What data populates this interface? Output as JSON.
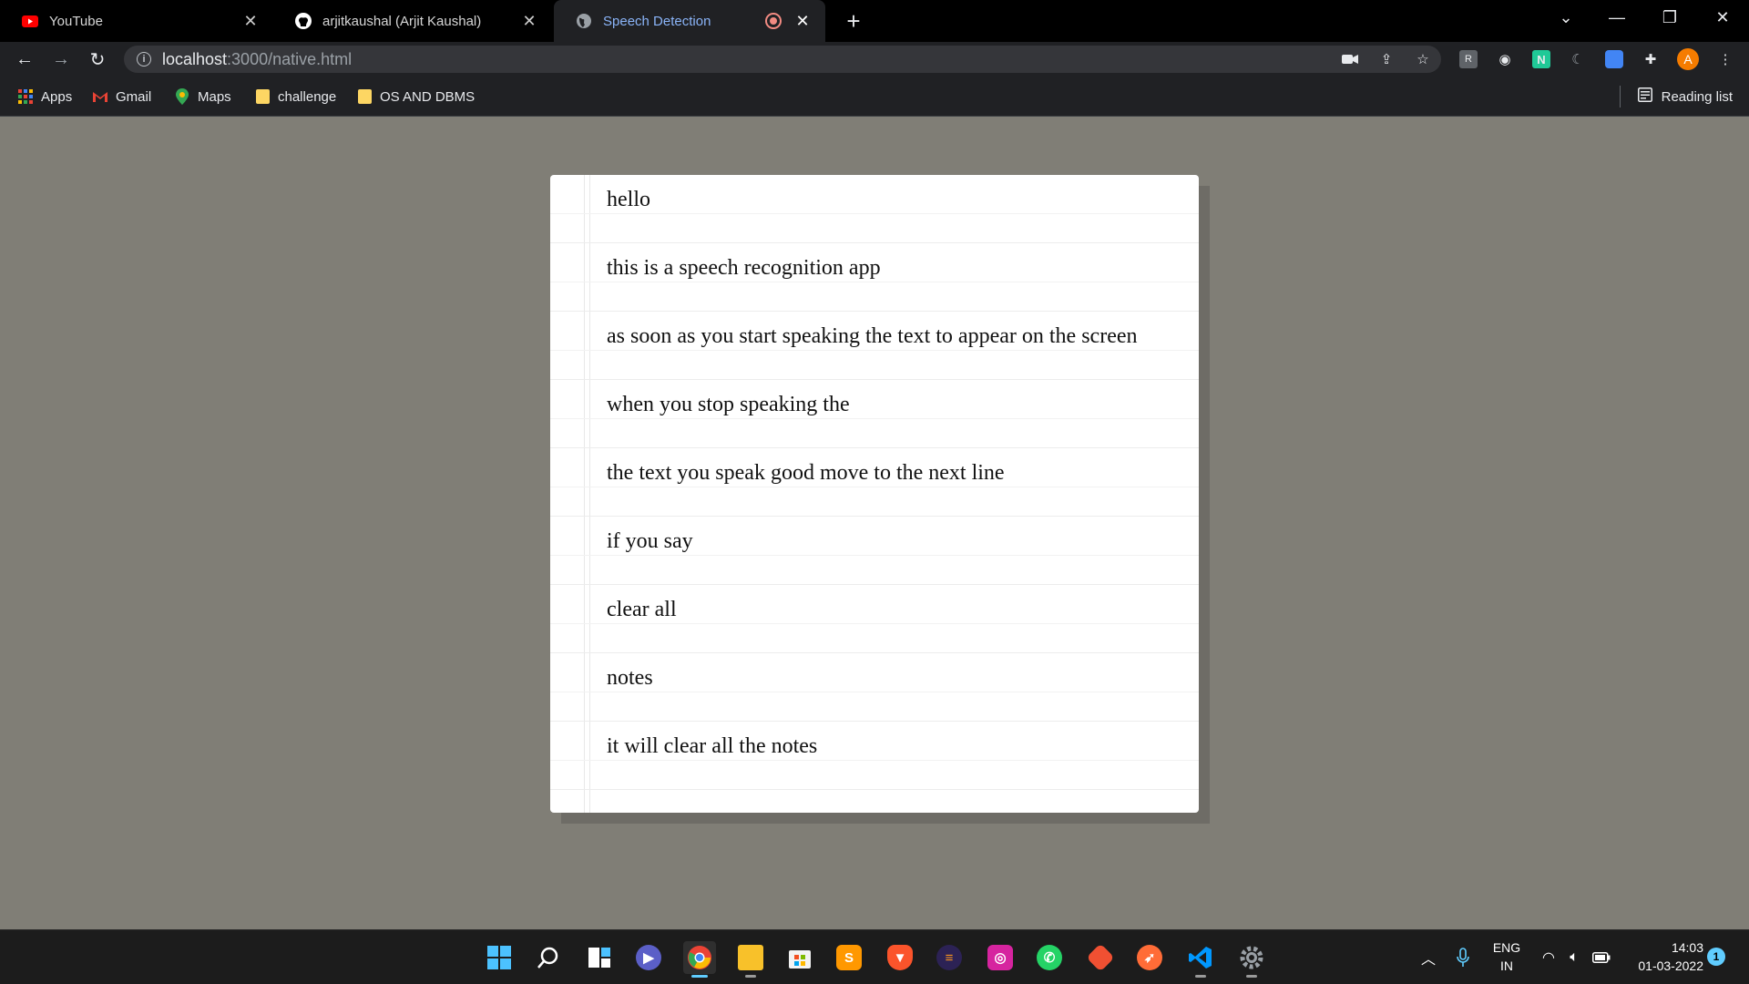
{
  "browser": {
    "tabs": [
      {
        "title": "YouTube",
        "icon": "youtube-icon",
        "active": false
      },
      {
        "title": "arjitkaushal (Arjit Kaushal)",
        "icon": "github-icon",
        "active": false
      },
      {
        "title": "Speech Detection",
        "icon": "globe-icon",
        "active": true,
        "recording": true
      }
    ],
    "address": {
      "host": "localhost",
      "path": ":3000/native.html"
    },
    "profile_initial": "A",
    "bookmarks": [
      {
        "label": "Apps",
        "icon": "apps-grid-icon"
      },
      {
        "label": "Gmail",
        "icon": "gmail-icon"
      },
      {
        "label": "Maps",
        "icon": "maps-pin-icon"
      },
      {
        "label": "challenge",
        "icon": "folder-icon"
      },
      {
        "label": "OS AND DBMS",
        "icon": "folder-icon"
      }
    ],
    "reading_list_label": "Reading list"
  },
  "notes": {
    "lines": [
      "hello",
      "this is a speech recognition app",
      "as soon as you start speaking the text to appear on the screen",
      "when you stop speaking the",
      "the text you speak good move to the next line",
      "if you say",
      "clear all",
      "notes",
      "it will clear all the notes"
    ]
  },
  "taskbar": {
    "apps": [
      "start-icon",
      "search-icon",
      "task-view-icon",
      "teams-chat-icon",
      "chrome-icon",
      "file-explorer-icon",
      "store-icon",
      "sublime-text-icon",
      "brave-icon",
      "eclipse-icon",
      "instagram-icon",
      "whatsapp-icon",
      "git-icon",
      "postman-icon",
      "vscode-icon",
      "settings-icon"
    ],
    "language": {
      "line1": "ENG",
      "line2": "IN"
    },
    "time": "14:03",
    "date": "01-03-2022",
    "notification_count": "1"
  }
}
